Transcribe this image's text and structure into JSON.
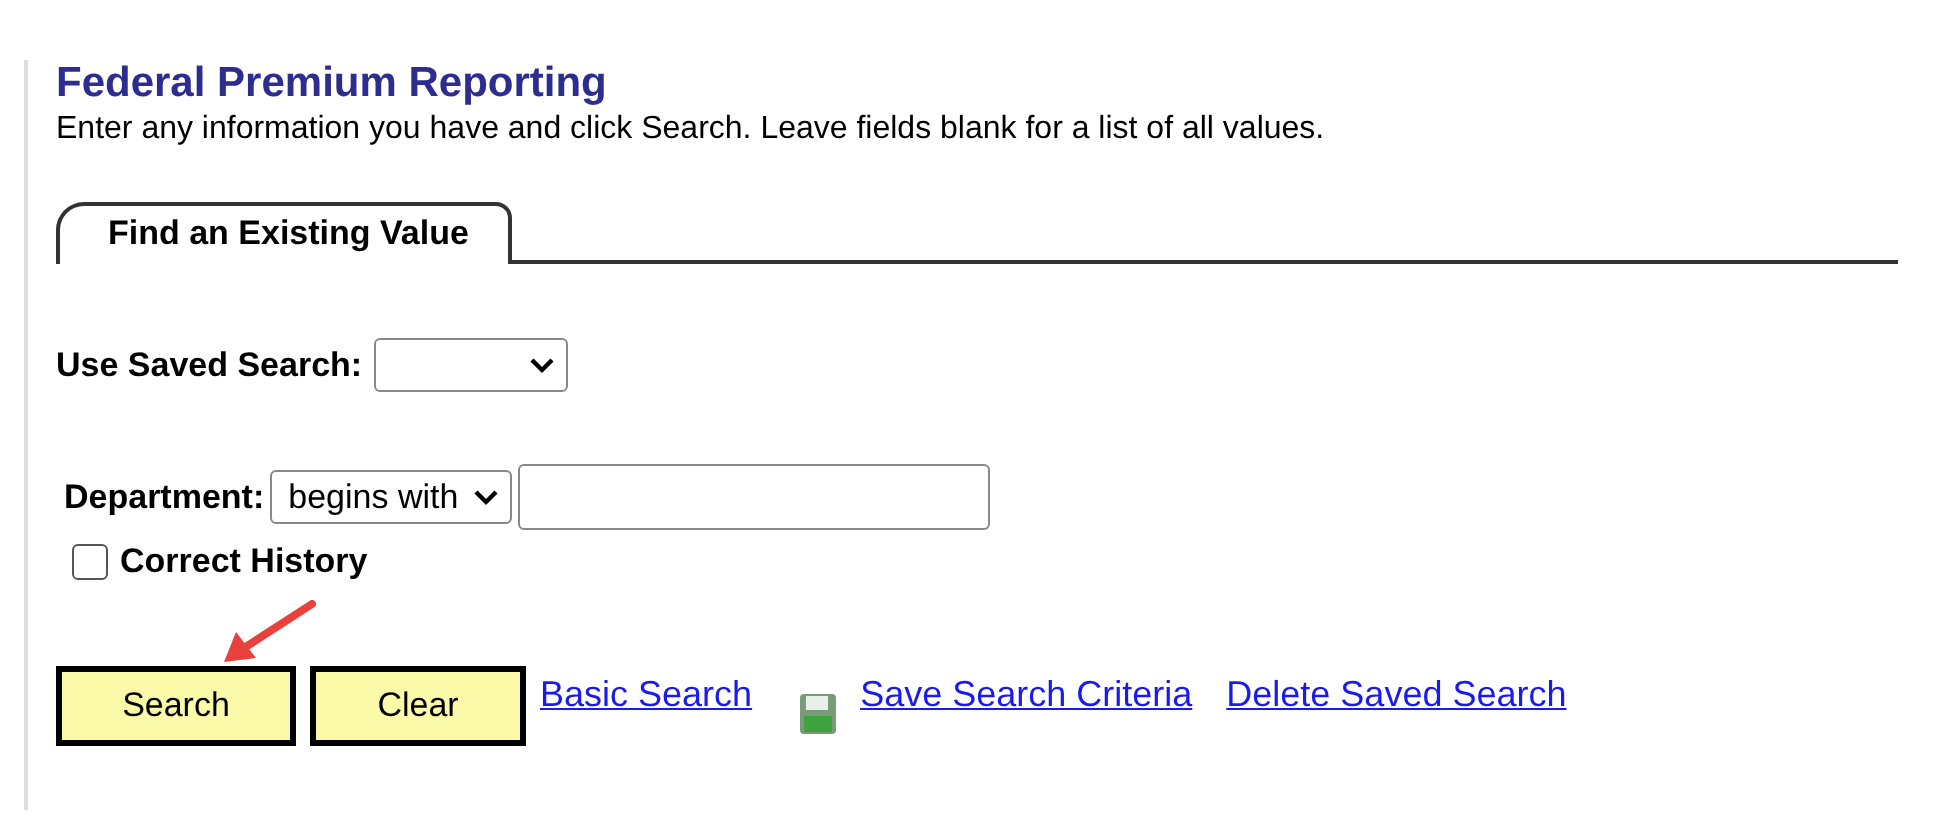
{
  "page": {
    "title": "Federal Premium Reporting",
    "instructions": "Enter any information you have and click Search. Leave fields blank for a list of all values."
  },
  "tabs": [
    {
      "label": "Find an Existing Value",
      "selected": true
    }
  ],
  "saved_search": {
    "label": "Use Saved Search:"
  },
  "department": {
    "label": "Department:",
    "operator": "begins with"
  },
  "correct_history": {
    "label": "Correct History",
    "checked": false
  },
  "buttons": [
    "Search",
    "Clear"
  ],
  "links": [
    {
      "label": "Basic Search",
      "kind": "link"
    },
    {
      "label": "Save Search Criteria",
      "kind": "save"
    },
    {
      "label": "Delete Saved Search",
      "kind": "link"
    }
  ]
}
